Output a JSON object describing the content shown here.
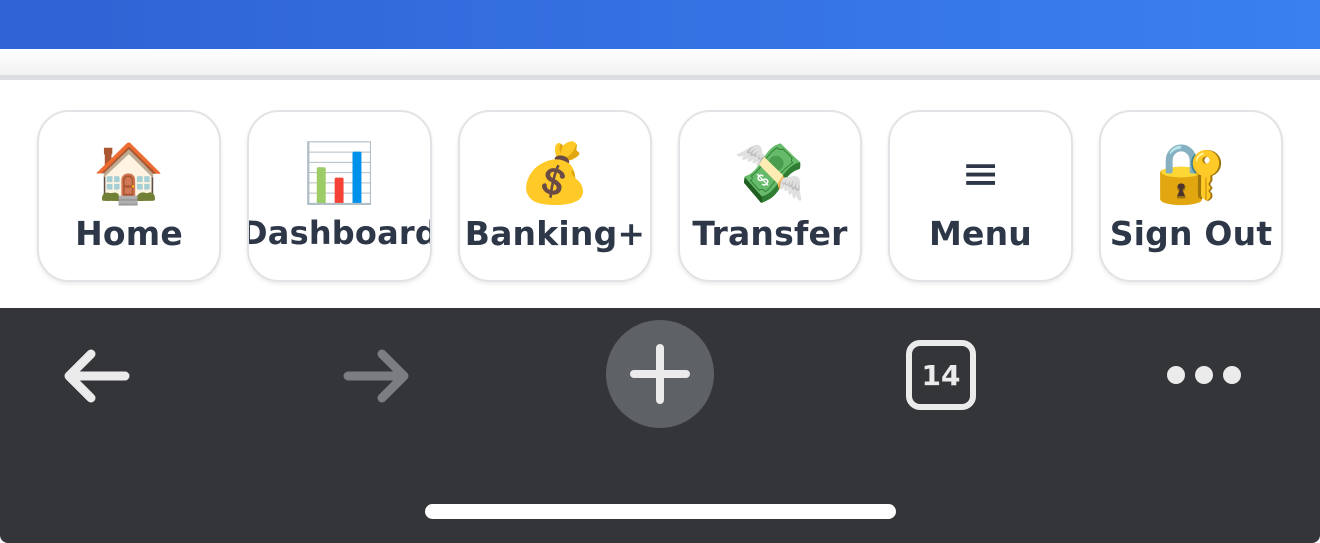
{
  "nav": {
    "items": [
      {
        "icon": "🏠",
        "icon_name": "house-icon",
        "label": "Home"
      },
      {
        "icon": "📊",
        "icon_name": "bar-chart-icon",
        "label": "Dashboard"
      },
      {
        "icon": "💰",
        "icon_name": "money-bag-icon",
        "label": "Banking+"
      },
      {
        "icon": "💸",
        "icon_name": "money-with-wings-icon",
        "label": "Transfer"
      },
      {
        "icon": "≡",
        "icon_name": "hamburger-menu-icon",
        "label": "Menu"
      },
      {
        "icon": "🔐",
        "icon_name": "lock-with-key-icon",
        "label": "Sign Out"
      }
    ]
  },
  "toolbar": {
    "back_icon": "back-arrow-icon",
    "forward_icon": "forward-arrow-icon",
    "new_tab_icon": "plus-icon",
    "tab_count": "14",
    "more_icon": "more-dots-icon"
  },
  "colors": {
    "header_gradient_start": "#2f62d4",
    "header_gradient_end": "#3a80f0",
    "nav_text": "#2d3748",
    "toolbar_bg": "#333538"
  }
}
